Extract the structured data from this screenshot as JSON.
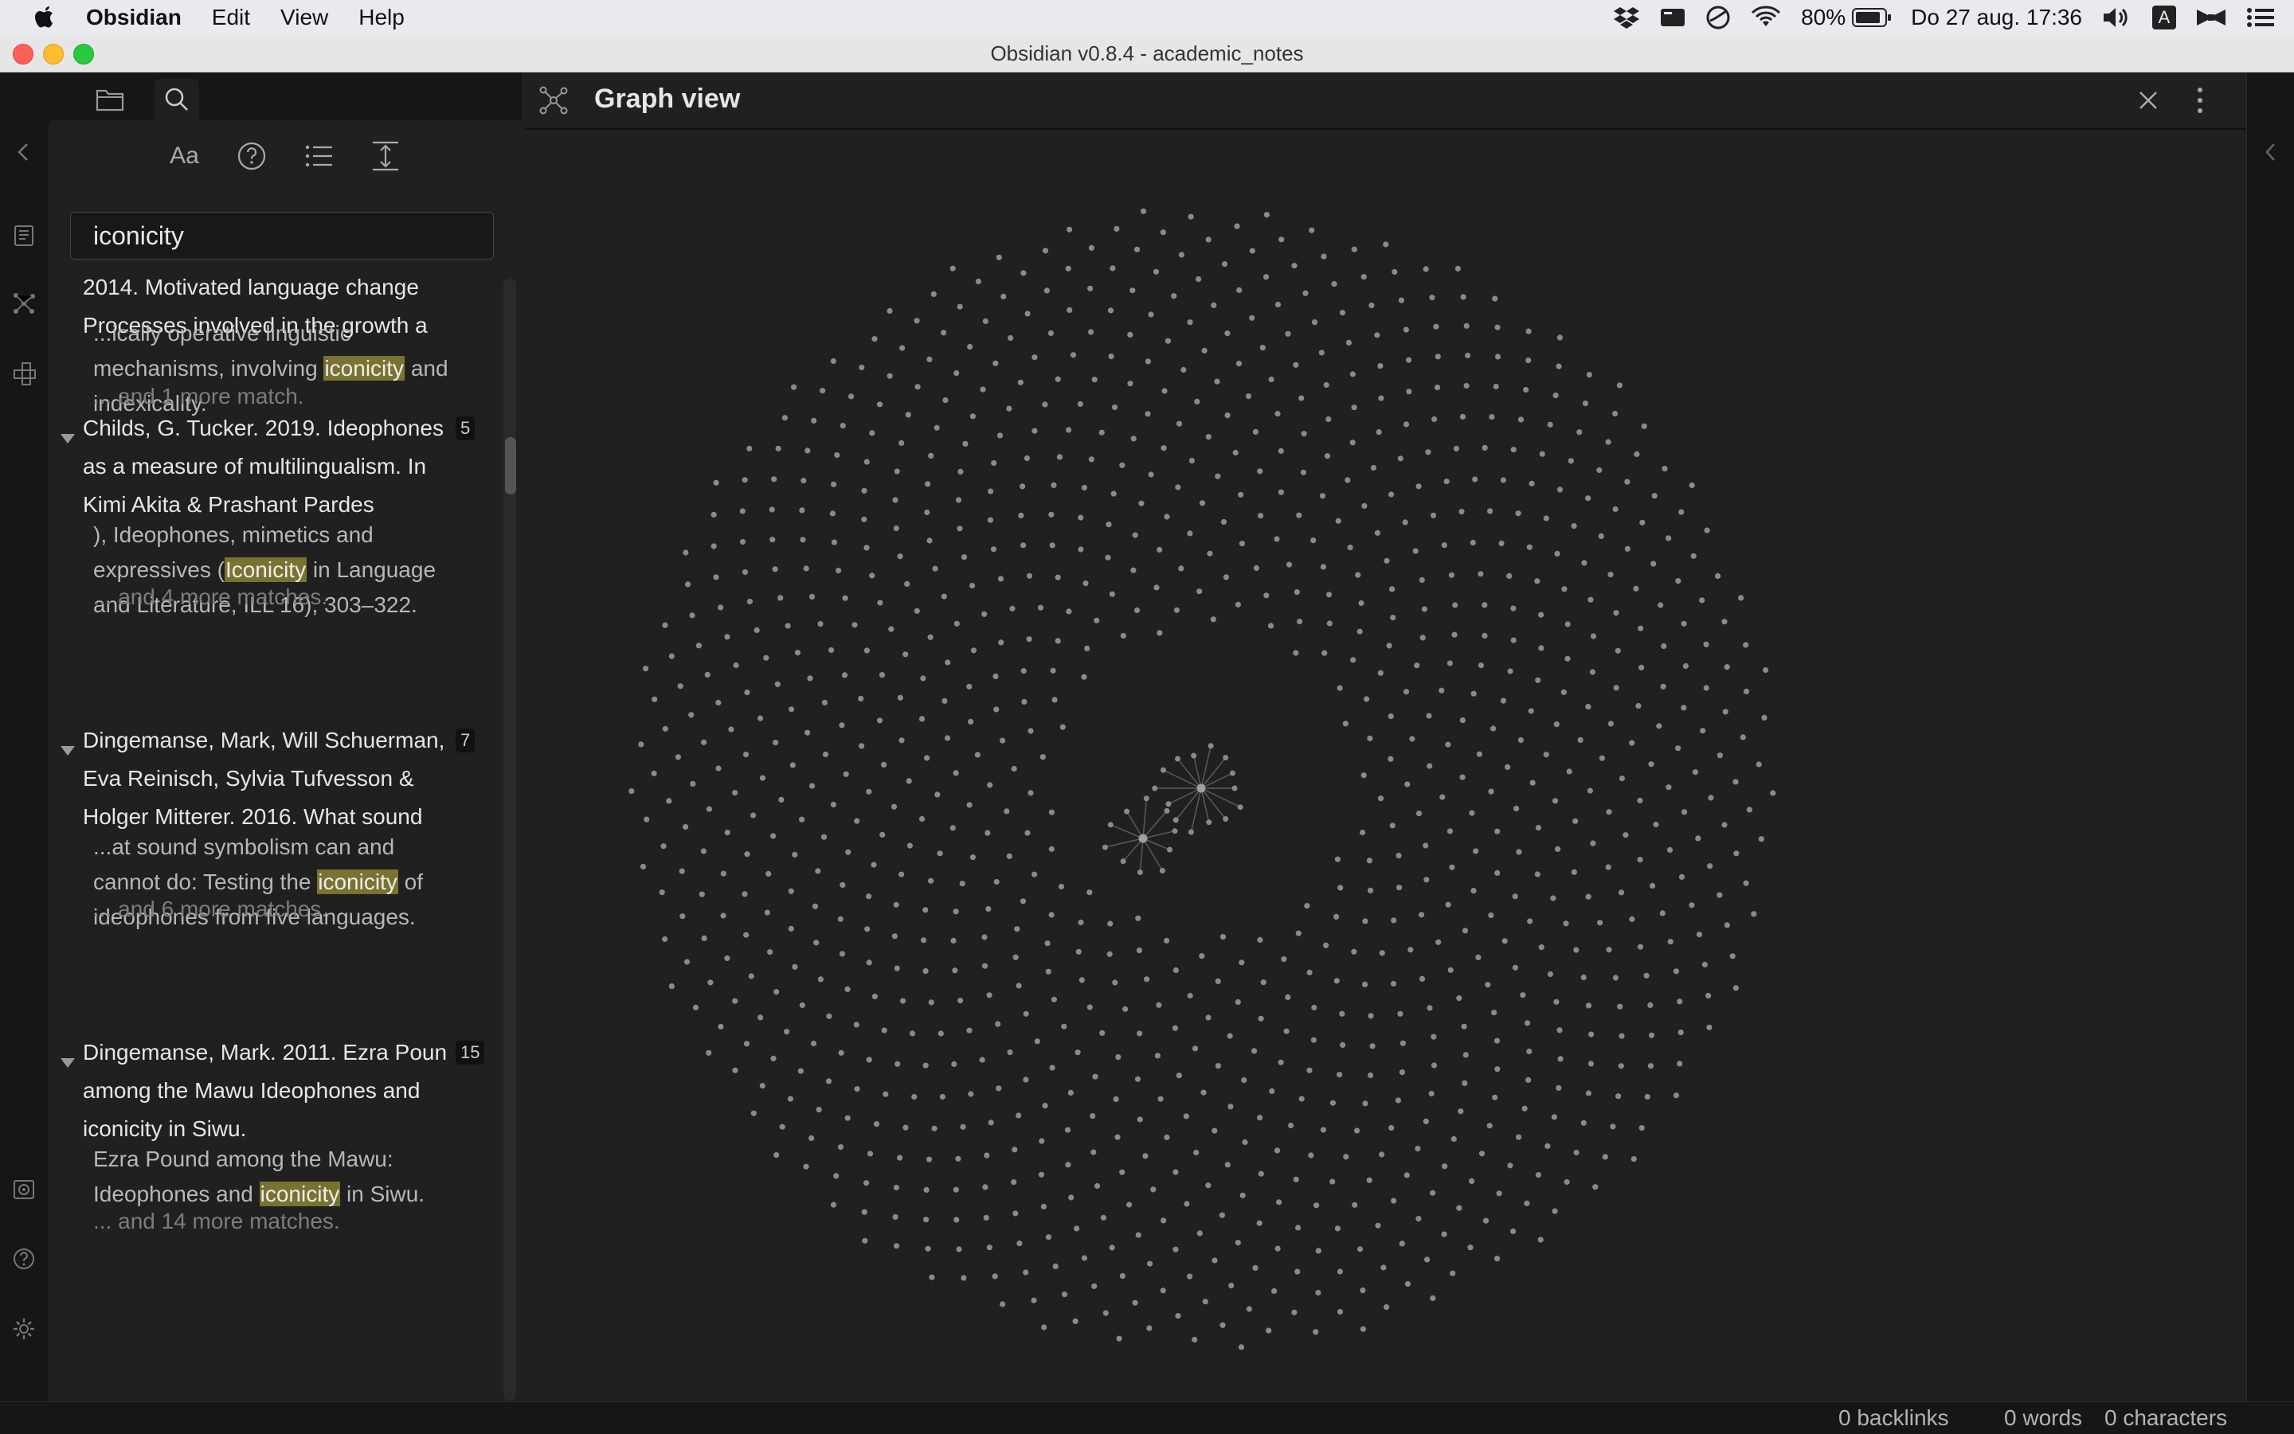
{
  "menubar": {
    "app_name": "Obsidian",
    "items": [
      "Edit",
      "View",
      "Help"
    ],
    "battery": "80%",
    "datetime": "Do 27 aug.  17:36",
    "input_source": "A"
  },
  "window": {
    "title": "Obsidian v0.8.4 - academic_notes"
  },
  "search": {
    "query": "iconicity",
    "toolbar": {
      "match_case_label": "Aa"
    },
    "results": [
      {
        "title_lines": [
          "2014. Motivated language change",
          "Processes involved in the growth a"
        ],
        "snippet_lines": [
          {
            "pre": "...ically operative linguistic",
            "hl": "",
            "post": ""
          },
          {
            "pre": "mechanisms, involving ",
            "hl": "iconicity",
            "post": " and"
          },
          {
            "pre": "indexicality.",
            "hl": "",
            "post": ""
          }
        ],
        "more": "... and 1 more match."
      },
      {
        "count": "5",
        "title_lines": [
          "Childs, G. Tucker. 2019. Ideophones",
          "as a measure of multilingualism. In",
          "Kimi Akita & Prashant Pardes"
        ],
        "snippet_lines": [
          {
            "pre": "), Ideophones, mimetics and",
            "hl": "",
            "post": ""
          },
          {
            "pre": "expressives (",
            "hl": "Iconicity",
            "post": " in Language"
          },
          {
            "pre": "and Literature, ILL 16), 303–322.",
            "hl": "",
            "post": ""
          }
        ],
        "more": "... and 4 more matches."
      },
      {
        "count": "7",
        "title_lines": [
          "Dingemanse, Mark, Will Schuerman,",
          "Eva Reinisch, Sylvia Tufvesson &",
          "Holger Mitterer. 2016. What sound"
        ],
        "snippet_lines": [
          {
            "pre": "...at sound symbolism can and",
            "hl": "",
            "post": ""
          },
          {
            "pre": "cannot do: Testing the ",
            "hl": "iconicity",
            "post": " of"
          },
          {
            "pre": "ideophones from five languages.",
            "hl": "",
            "post": ""
          }
        ],
        "more": "... and 6 more matches."
      },
      {
        "count": "15",
        "title_lines": [
          "Dingemanse, Mark. 2011. Ezra Poun",
          "among the Mawu Ideophones and",
          "iconicity in Siwu."
        ],
        "snippet_lines": [
          {
            "pre": "Ezra Pound among the Mawu:",
            "hl": "",
            "post": ""
          },
          {
            "pre": "Ideophones and ",
            "hl": "iconicity",
            "post": " in Siwu."
          }
        ],
        "more": "... and 14 more matches."
      }
    ]
  },
  "graph": {
    "title": "Graph view",
    "node_color": "#8a8a8a",
    "edge_color": "#5a5a5a"
  },
  "status": {
    "backlinks": "0 backlinks",
    "words": "0 words",
    "characters": "0 characters"
  },
  "colors": {
    "accent_highlight": "#7a7231",
    "background": "#202020",
    "sidebar": "#161616"
  }
}
